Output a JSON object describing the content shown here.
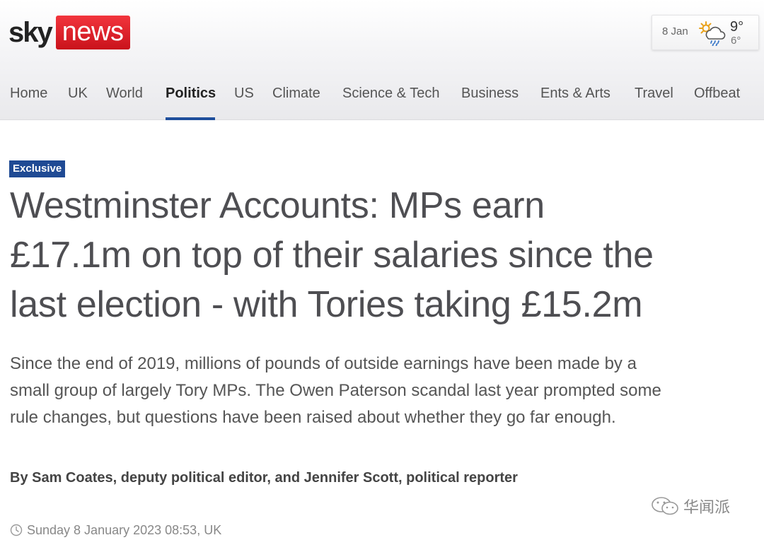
{
  "brand": {
    "logo_sky": "sky",
    "logo_news": "news",
    "accent_red": "#e0191f",
    "nav_accent": "#1f4f9c"
  },
  "weather": {
    "date": "8 Jan",
    "high": "9°",
    "low": "6°",
    "icon": "sun-cloud-rain-icon"
  },
  "nav": {
    "items": [
      "Home",
      "UK",
      "World",
      "Politics",
      "US",
      "Climate",
      "Science & Tech",
      "Business",
      "Ents & Arts",
      "Travel",
      "Offbeat"
    ],
    "active": "Politics"
  },
  "article": {
    "badge": "Exclusive",
    "headline_lines": [
      "Westminster Accounts: MPs earn",
      "£17.1m on top of their salaries since the",
      "last election - with Tories taking £15.2m"
    ],
    "standfirst_lines": [
      "Since the end of 2019, millions of pounds of outside earnings have been made by a",
      "small group of largely Tory MPs. The Owen Paterson scandal last year prompted some",
      "rule changes, but questions have been raised about whether they go far enough."
    ],
    "byline": "By Sam Coates, deputy political editor, and Jennifer Scott, political reporter",
    "published": "Sunday 8 January 2023 08:53, UK"
  },
  "watermark": {
    "text": "华闻派",
    "icon": "wechat-icon"
  }
}
